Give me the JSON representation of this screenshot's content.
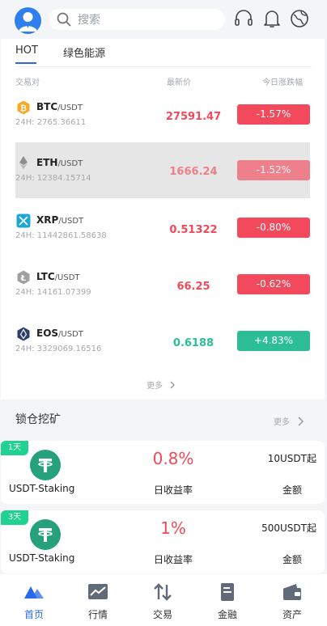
{
  "search": {
    "placeholder": "搜索"
  },
  "tabs": {
    "hot": "HOT",
    "green": "绿色能源"
  },
  "columns": {
    "pair": "交易对",
    "price": "最新价",
    "change": "今日涨跌幅"
  },
  "markets": [
    {
      "base": "BTC",
      "quote": "/USDT",
      "volume": "24H: 2765.36611",
      "price": "27591.47",
      "change": "-1.57%",
      "direction": "down",
      "icon": "bitcoin-icon",
      "icon_color": "#f7a827"
    },
    {
      "base": "ETH",
      "quote": "/USDT",
      "volume": "24H: 12384.15714",
      "price": "1666.24",
      "change": "-1.52%",
      "direction": "down",
      "icon": "ethereum-icon",
      "icon_color": "#8c8c8c"
    },
    {
      "base": "XRP",
      "quote": "/USDT",
      "volume": "24H: 11442861.58638",
      "price": "0.51322",
      "change": "-0.80%",
      "direction": "down",
      "icon": "xrp-icon",
      "icon_color": "#1aa6d8"
    },
    {
      "base": "LTC",
      "quote": "/USDT",
      "volume": "24H: 14161.07399",
      "price": "66.25",
      "change": "-0.62%",
      "direction": "down",
      "icon": "litecoin-icon",
      "icon_color": "#a0a0a0"
    },
    {
      "base": "EOS",
      "quote": "/USDT",
      "volume": "24H: 3329069.16516",
      "price": "0.6188",
      "change": "+4.83%",
      "direction": "up",
      "icon": "eos-icon",
      "icon_color": "#2c3e6a"
    }
  ],
  "more_label": "更多",
  "staking": {
    "title": "锁仓挖矿",
    "more_label": "更多",
    "items": [
      {
        "tag": "1天",
        "name": "USDT-Staking",
        "rate": "0.8%",
        "rate_label": "日收益率",
        "min": "10USDT起",
        "min_label": "金额"
      },
      {
        "tag": "3天",
        "name": "USDT-Staking",
        "rate": "1%",
        "rate_label": "日收益率",
        "min": "500USDT起",
        "min_label": "金额"
      }
    ]
  },
  "nav": [
    {
      "label": "首页",
      "icon": "home-icon"
    },
    {
      "label": "行情",
      "icon": "chart-icon"
    },
    {
      "label": "交易",
      "icon": "trade-icon"
    },
    {
      "label": "金融",
      "icon": "finance-icon"
    },
    {
      "label": "资产",
      "icon": "wallet-icon"
    }
  ],
  "colors": {
    "accent": "#2a6ae9",
    "down": "#f24a5c",
    "up": "#2dbe98",
    "tag": "#1fd28f",
    "tether": "#26a17b"
  }
}
